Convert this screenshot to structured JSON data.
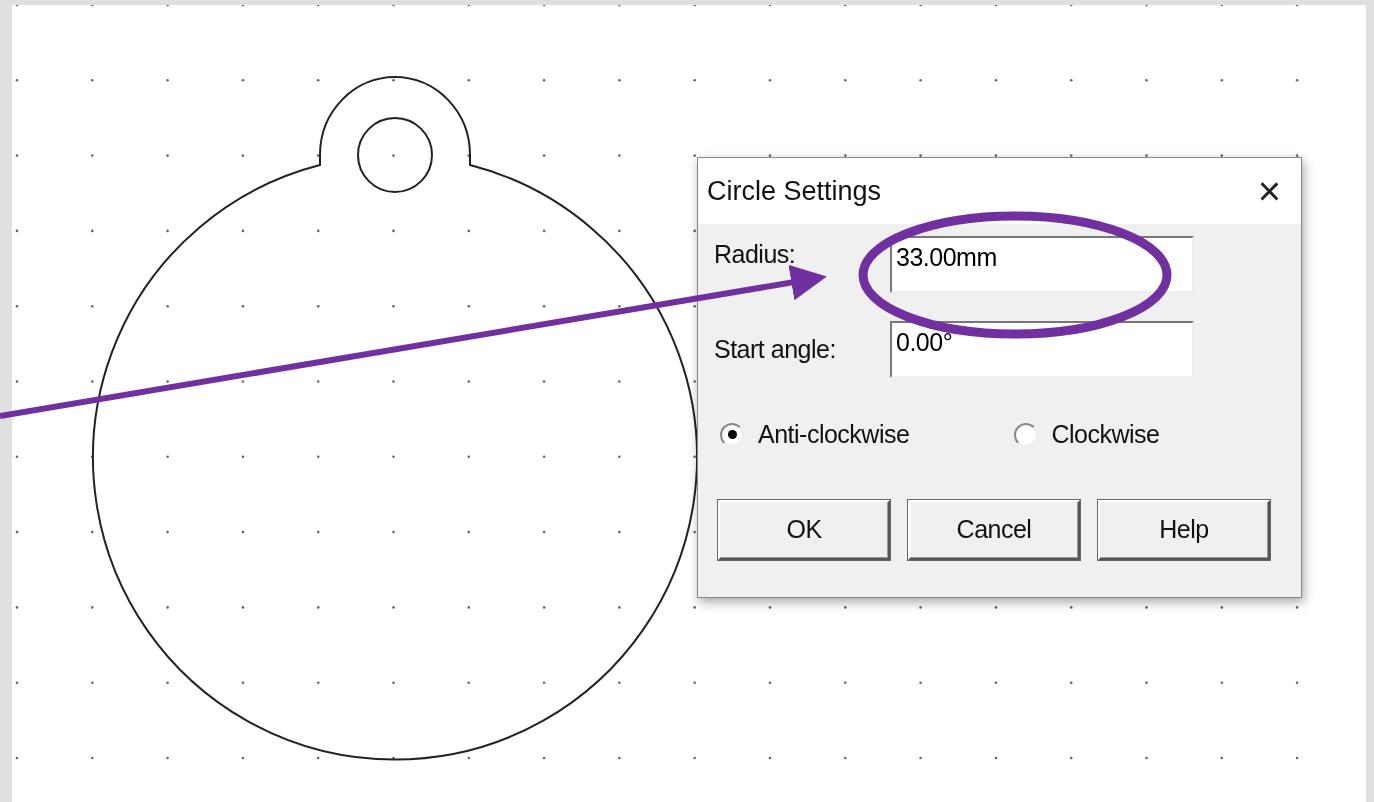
{
  "dialog": {
    "title": "Circle Settings",
    "close": "×",
    "fields": [
      {
        "label": "Radius:",
        "value": "33.00mm"
      },
      {
        "label": "Start angle:",
        "value": "0.00°"
      }
    ],
    "direction": [
      {
        "label": "Anti-clockwise",
        "selected": true
      },
      {
        "label": "Clockwise",
        "selected": false
      }
    ],
    "buttons": [
      "OK",
      "Cancel",
      "Help"
    ]
  }
}
